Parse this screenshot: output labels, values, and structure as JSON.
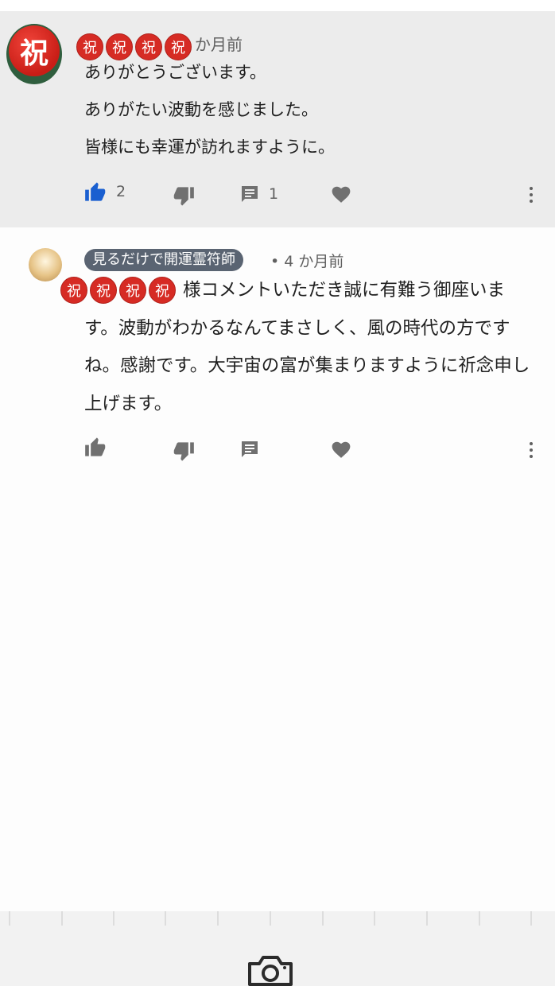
{
  "comment1": {
    "avatar_char": "祝",
    "name_badges": [
      "祝",
      "祝",
      "祝",
      "祝"
    ],
    "time": "か月前",
    "lines": [
      "ありがとうございます。",
      "ありがたい波動を感じました。",
      "皆様にも幸運が訪れますように。"
    ],
    "like_count": "2",
    "reply_count": "1"
  },
  "comment2": {
    "author": "見るだけで開運霊符師",
    "time": "• 4 か月前",
    "overlay_badges": [
      "祝",
      "祝",
      "祝",
      "祝"
    ],
    "text": "様コメントいただき誠に有難う御座います。波動がわかるなんてまさしく、風の時代の方ですね。感謝です。大宇宙の富が集まりますように祈念申し上げます。"
  },
  "colors": {
    "liked": "#1a5fd0",
    "icon": "#707070",
    "badge": "#d62b24"
  }
}
